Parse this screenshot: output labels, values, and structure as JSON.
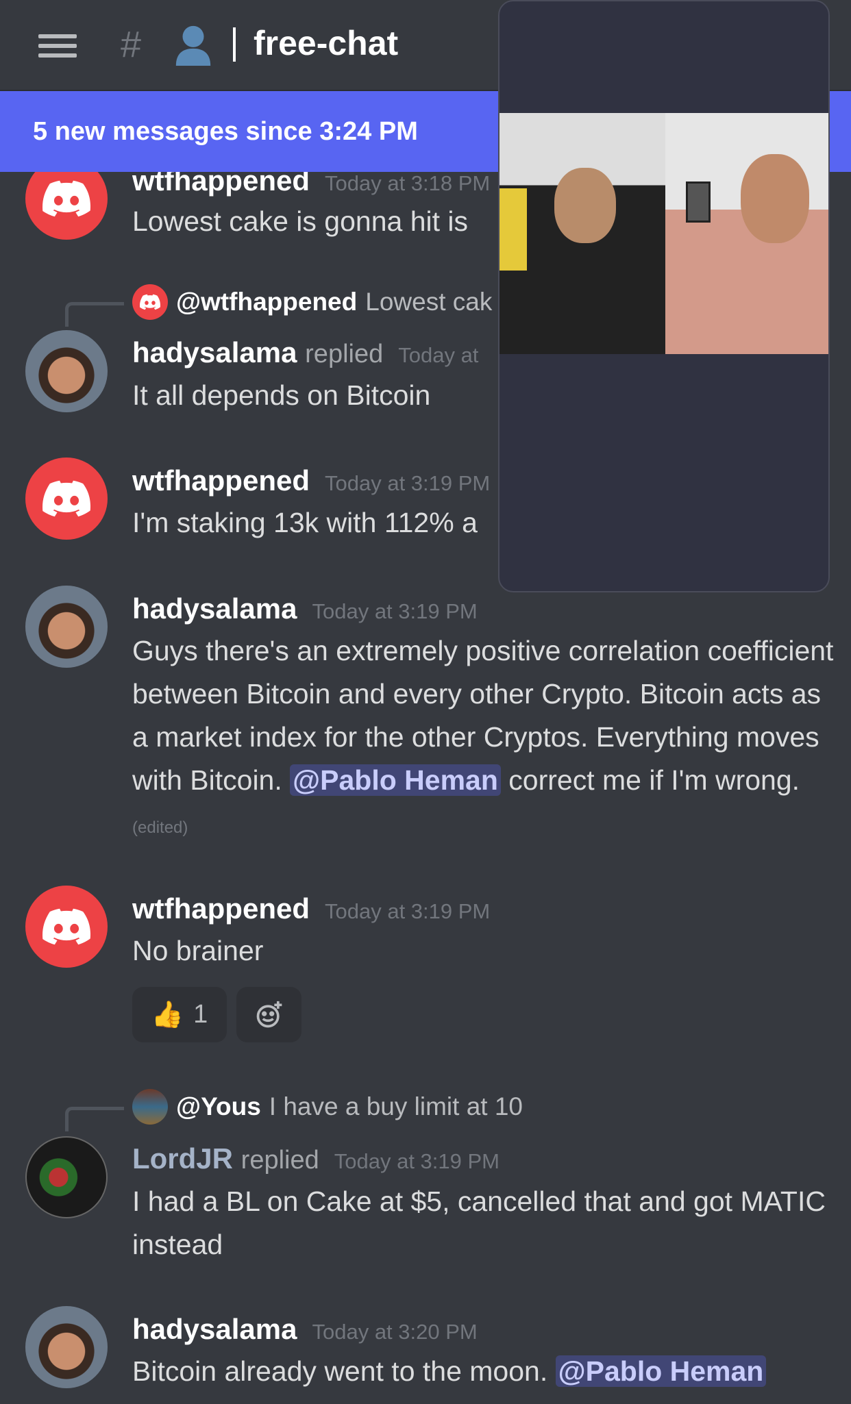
{
  "header": {
    "channel_title": "free-chat",
    "hash_icon": "#",
    "menu_icon": "hamburger-icon"
  },
  "banner": {
    "text": "5 new messages since 3:24 PM"
  },
  "messages": [
    {
      "author": "wtfhappened",
      "timestamp": "Today at 3:18 PM",
      "text": "Lowest cake is gonna hit is"
    },
    {
      "reply_to": "@wtfhappened",
      "reply_preview": "Lowest cak",
      "author": "hadysalama",
      "replied": "replied",
      "timestamp": "Today at",
      "text": "It all depends on Bitcoin"
    },
    {
      "author": "wtfhappened",
      "timestamp": "Today at 3:19 PM",
      "text": "I'm staking 13k with 112% a"
    },
    {
      "author": "hadysalama",
      "timestamp": "Today at 3:19 PM",
      "text": "Guys there's an extremely positive correlation coefficient between Bitcoin and every other Crypto. Bitcoin acts as a market index for the other Cryptos. Everything moves with Bitcoin.",
      "mention": "@Pablo Heman",
      "text_after": "correct me if I'm wrong.",
      "edited": "(edited)"
    },
    {
      "author": "wtfhappened",
      "timestamp": "Today at 3:19 PM",
      "text": "No brainer",
      "reaction": {
        "emoji": "👍",
        "count": "1"
      }
    },
    {
      "reply_to": "@Yous",
      "reply_preview": "I have a buy limit at 10",
      "author": "LordJR",
      "replied": "replied",
      "timestamp": "Today at 3:19 PM",
      "text": "I had a BL on Cake at $5, cancelled that and got MATIC instead"
    },
    {
      "author": "hadysalama",
      "timestamp": "Today at 3:20 PM",
      "text": "Bitcoin already went to the moon.",
      "mention": "@Pablo Heman"
    }
  ],
  "colors": {
    "accent": "#5865f2",
    "discord_red": "#ed4245",
    "bg": "#36393f"
  }
}
